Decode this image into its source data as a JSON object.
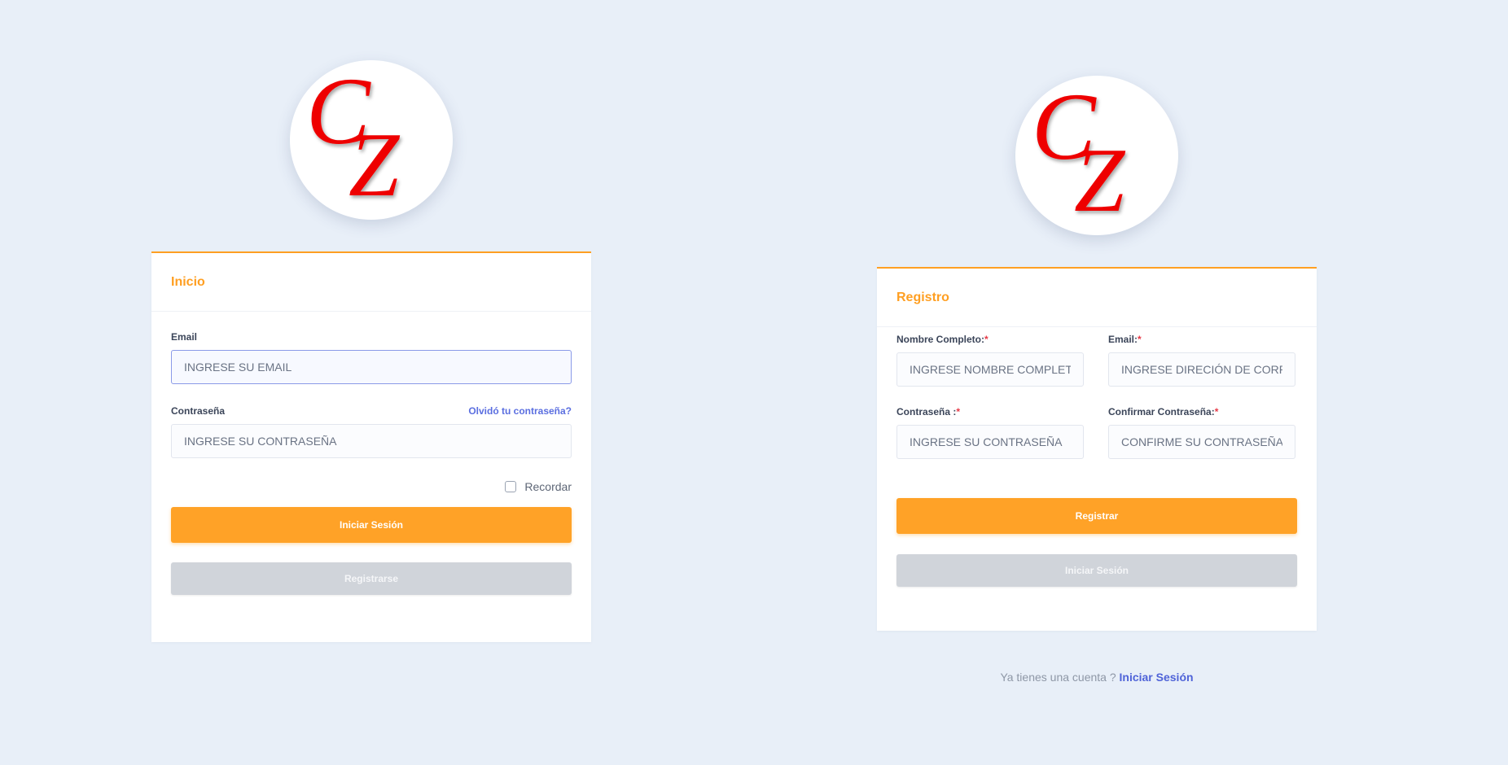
{
  "brand": {
    "logo_text_c": "C",
    "logo_text_z": "Z",
    "logo_color": "#ee0000"
  },
  "colors": {
    "accent": "#ff9f22",
    "link": "#5a6ee0",
    "required": "#e63946",
    "secondary_button": "#d0d4da",
    "background": "#e8eff8"
  },
  "login": {
    "title": "Inicio",
    "email_label": "Email",
    "email_placeholder": "INGRESE SU EMAIL",
    "password_label": "Contraseña",
    "forgot_link": "Olvidó tu contraseña?",
    "password_placeholder": "INGRESE SU CONTRASEÑA",
    "remember_label": "Recordar",
    "remember_checked": false,
    "submit_label": "Iniciar Sesión",
    "register_label": "Registrarse"
  },
  "register": {
    "title": "Registro",
    "fullname_label": "Nombre Completo:",
    "fullname_placeholder": "INGRESE NOMBRE COMPLETO",
    "email_label": "Email:",
    "email_placeholder": "INGRESE DIRECIÓN DE CORREO",
    "password_label": "Contraseña :",
    "password_placeholder": "INGRESE SU CONTRASEÑA",
    "confirm_label": "Confirmar Contraseña:",
    "confirm_placeholder": "CONFIRME SU CONTRASEÑA",
    "required_mark": "*",
    "submit_label": "Registrar",
    "login_label": "Iniciar Sesión",
    "footer_text": "Ya tienes una cuenta ?",
    "footer_link": "Iniciar Sesión"
  }
}
